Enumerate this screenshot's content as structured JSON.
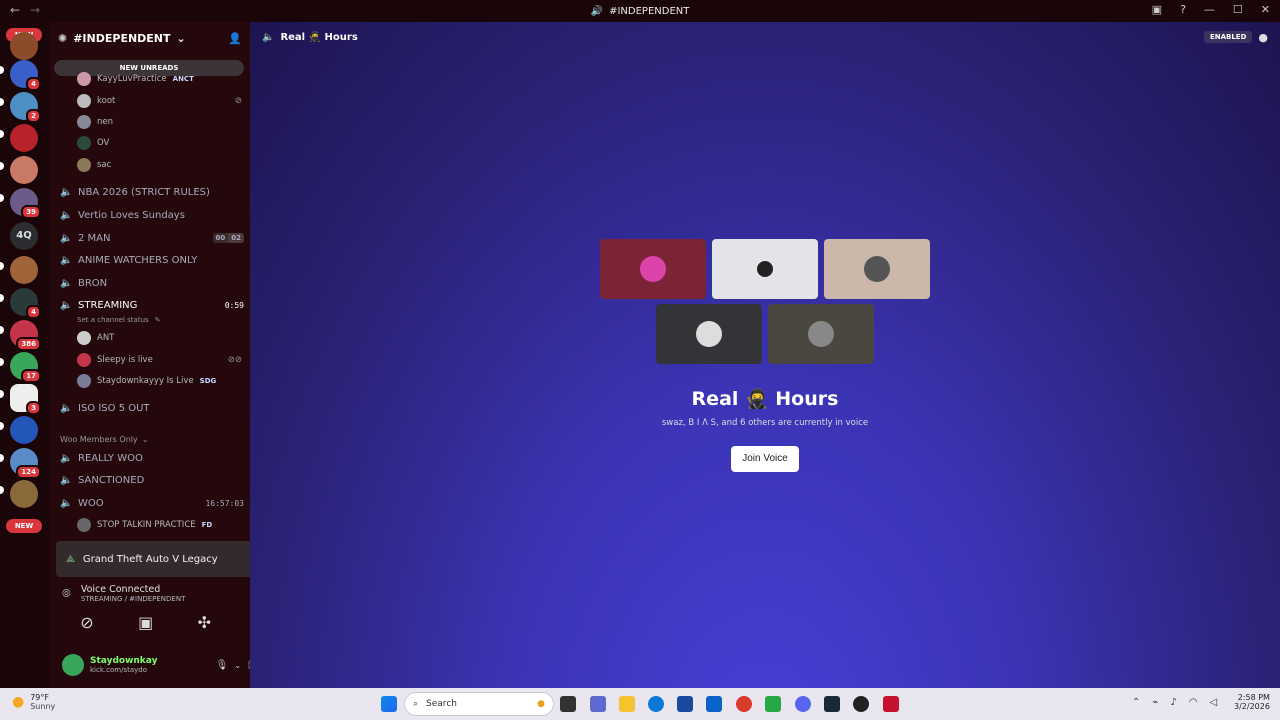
{
  "window": {
    "title": "#INDEPENDENT"
  },
  "server_list": {
    "new_badge_top": "NEW",
    "new_badge_bottom": "NEW",
    "badges": [
      "4",
      "2",
      "39",
      "4",
      "386",
      "17",
      "3",
      "124"
    ],
    "text_server": "4Q"
  },
  "sidebar": {
    "server_name": "#INDEPENDENT",
    "new_unreads": "NEW UNREADS",
    "top_users": [
      {
        "name": "KayyLuvPractice",
        "tag": "ANCT"
      },
      {
        "name": "koot",
        "tag": ""
      },
      {
        "name": "nen",
        "tag": ""
      },
      {
        "name": "OV",
        "tag": ""
      },
      {
        "name": "sac",
        "tag": ""
      }
    ],
    "channels_a": [
      "NBA 2026 (STRICT RULES)",
      "Vertio Loves Sundays"
    ],
    "two_man": {
      "label": "2 MAN",
      "count_a": "00",
      "count_b": "02"
    },
    "channels_b": [
      "ANIME WATCHERS ONLY",
      "BRON"
    ],
    "streaming": {
      "label": "STREAMING",
      "timer": "0:59",
      "status": "Set a channel status"
    },
    "streaming_users": [
      {
        "name": "ANT",
        "tag": ""
      },
      {
        "name": "Sleepy is live",
        "tag": ""
      },
      {
        "name": "Staydownkayyy Is Live",
        "tag": "SDG"
      }
    ],
    "iso": "ISO ISO 5 OUT",
    "category": "Woo Members Only",
    "channels_c": [
      "REALLY WOO",
      "SANCTIONED"
    ],
    "woo": {
      "label": "WOO",
      "timer": "16:57:03"
    },
    "woo_users": [
      {
        "name": "STOP TALKIN PRACTICE",
        "tag": "FD"
      }
    ],
    "game": "Grand Theft Auto V Legacy",
    "voice": {
      "status": "Voice Connected",
      "location": "STREAMING / #INDEPENDENT"
    },
    "user": {
      "name": "Staydownkay",
      "status": "kick.com/staydo"
    }
  },
  "main": {
    "channel_name": "Real 🥷 Hours",
    "enabled_label": "ENABLED",
    "title": "Real 🥷 Hours",
    "subtitle": "swaz, B I Λ S, and 6 others are currently in voice",
    "join_button": "Join Voice"
  },
  "taskbar": {
    "weather_temp": "79°F",
    "weather_desc": "Sunny",
    "search_placeholder": "Search",
    "time": "2:58 PM",
    "date": "3/2/2026"
  },
  "colors": {
    "accent": "#5865f2",
    "danger": "#da373c",
    "live_green": "#23a55a"
  }
}
